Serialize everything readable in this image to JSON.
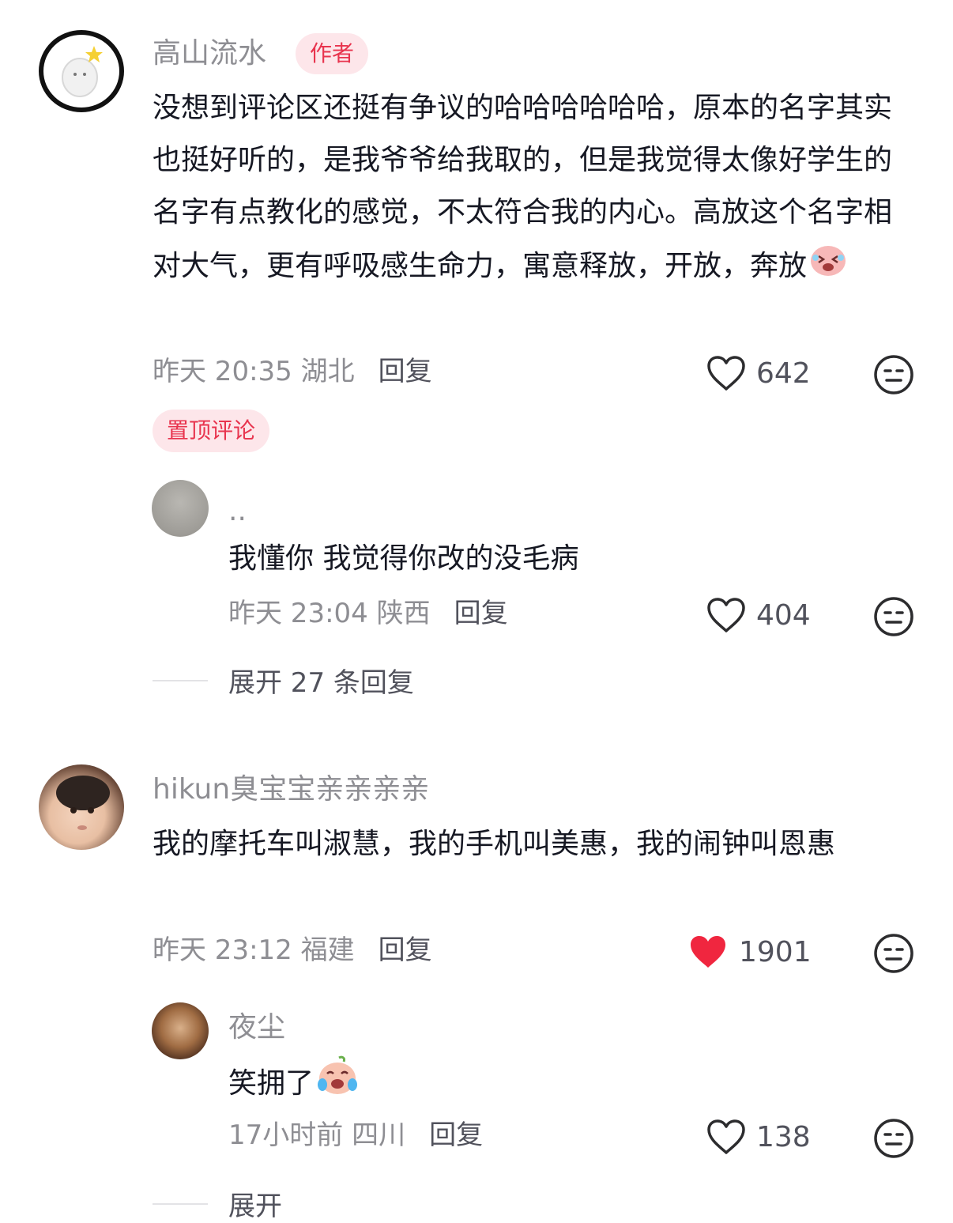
{
  "comments": [
    {
      "author": "高山流水",
      "badge": "作者",
      "text": "没想到评论区还挺有争议的哈哈哈哈哈哈，原本的名字其实也挺好听的，是我爷爷给我取的，但是我觉得太像好学生的名字有点教化的感觉，不太符合我的内心。高放这个名字相对大气，更有呼吸感生命力，寓意释放，开放，奔放",
      "meta": "昨天 20:35 湖北",
      "reply_label": "回复",
      "likes": "642",
      "liked": false,
      "pinned_label": "置顶评论",
      "replies": [
        {
          "author": "..",
          "text": "我懂你 我觉得你改的没毛病",
          "meta": "昨天 23:04 陕西",
          "reply_label": "回复",
          "likes": "404"
        }
      ],
      "expand_label": "展开 27 条回复"
    },
    {
      "author": "hikun臭宝宝亲亲亲亲",
      "text": "我的摩托车叫淑慧，我的手机叫美惠，我的闹钟叫恩惠",
      "meta": "昨天 23:12 福建",
      "reply_label": "回复",
      "likes": "1901",
      "liked": true,
      "replies": [
        {
          "author": "夜尘",
          "text": "笑拥了",
          "meta": "17小时前 四川",
          "reply_label": "回复",
          "likes": "138"
        }
      ],
      "expand_label": "展开"
    }
  ],
  "colors": {
    "accent": "#e8344e",
    "muted": "#8e8e93",
    "text": "#161823"
  }
}
